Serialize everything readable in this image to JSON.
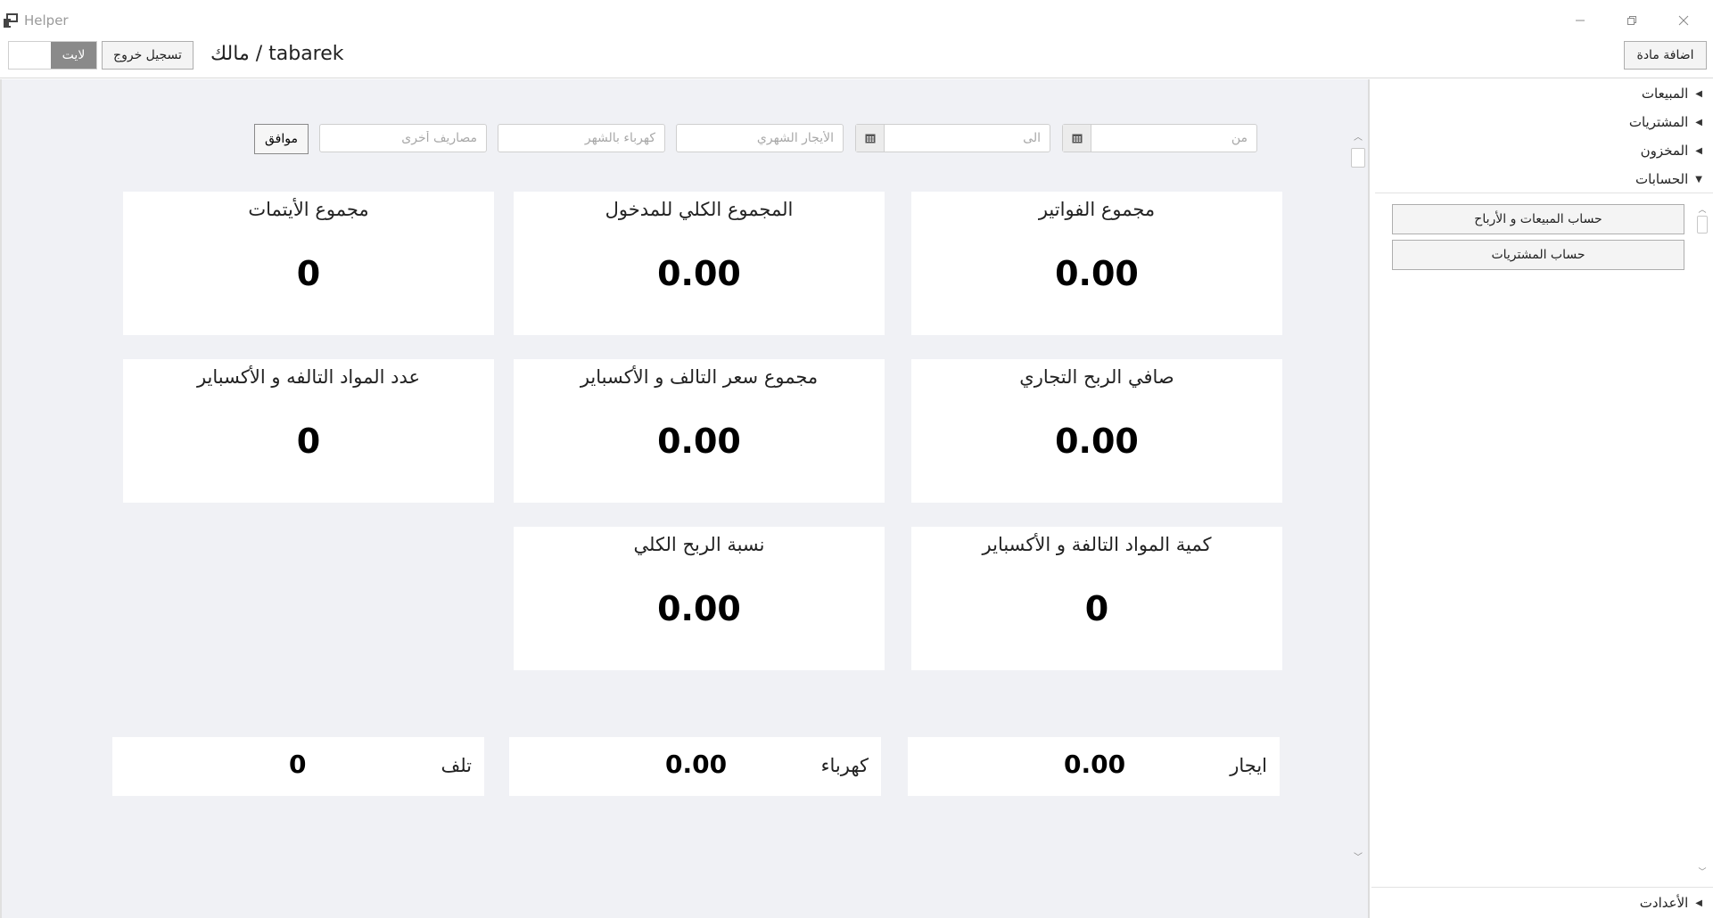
{
  "window": {
    "title": "Helper",
    "controls": [
      "minimize",
      "restore",
      "close"
    ]
  },
  "toolbar": {
    "theme_toggle_label": "لايت",
    "logout_label": "تسجيل خروج",
    "user_label": "مالك / tabarek",
    "add_item_label": "اضافة مادة"
  },
  "filters": {
    "from_placeholder": "من",
    "to_placeholder": "الى",
    "monthly_rent_placeholder": "الأيجار الشهري",
    "monthly_electricity_placeholder": "كهرباء بالشهر",
    "other_expenses_placeholder": "مصاريف أخرى",
    "ok_label": "موافق"
  },
  "cards": [
    {
      "label": "مجموع الفواتير",
      "value": "0.00"
    },
    {
      "label": "المجموع الكلي للمدخول",
      "value": "0.00"
    },
    {
      "label": "مجموع الأيتمات",
      "value": "0"
    },
    {
      "label": "صافي الربح التجاري",
      "value": "0.00"
    },
    {
      "label": "مجموع سعر التالف و الأكسباير",
      "value": "0.00"
    },
    {
      "label": "عدد المواد التالفه و الأكسباير",
      "value": "0"
    },
    {
      "label": "كمية المواد التالفة و الأكسباير",
      "value": "0"
    },
    {
      "label": "نسبة الربح الكلي",
      "value": "0.00"
    }
  ],
  "summary": [
    {
      "label": "ايجار",
      "value": "0.00"
    },
    {
      "label": "كهرباء",
      "value": "0.00"
    },
    {
      "label": "تلف",
      "value": "0"
    }
  ],
  "sidebar": {
    "items": [
      {
        "label": "المبيعات",
        "expanded": false
      },
      {
        "label": "المشتريات",
        "expanded": false
      },
      {
        "label": "المخزون",
        "expanded": false
      },
      {
        "label": "الحسابات",
        "expanded": true
      }
    ],
    "sub_buttons": [
      "حساب المبيعات و الأرباح",
      "حساب المشتريات"
    ],
    "settings_label": "الأعدادت"
  },
  "colors": {
    "background": "#f0f1f5",
    "card": "#ffffff",
    "toggle_knob": "#8a8a8a"
  }
}
